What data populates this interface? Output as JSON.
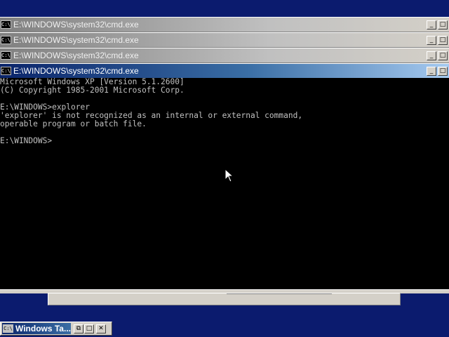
{
  "windows": [
    {
      "title": "E:\\WINDOWS\\system32\\cmd.exe",
      "state": "inactive"
    },
    {
      "title": "E:\\WINDOWS\\system32\\cmd.exe",
      "state": "inactive"
    },
    {
      "title": "E:\\WINDOWS\\system32\\cmd.exe",
      "state": "inactive"
    },
    {
      "title": "E:\\WINDOWS\\system32\\cmd.exe",
      "state": "active"
    }
  ],
  "caption_buttons": {
    "minimize": "_",
    "maximize": "□"
  },
  "system_icon_text": "C:\\",
  "console_lines": [
    "Microsoft Windows XP [Version 5.1.2600]",
    "(C) Copyright 1985-2001 Microsoft Corp.",
    "",
    "E:\\WINDOWS>explorer",
    "'explorer' is not recognized as an internal or external command,",
    "operable program or batch file.",
    "",
    "E:\\WINDOWS>"
  ],
  "minimized_window": {
    "title": "Windows Ta...",
    "restore": "⧉",
    "maximize": "□",
    "close": "✕"
  },
  "colors": {
    "desktop": "#0b1b6e",
    "active_title": "#0a246a",
    "inactive_title": "#808080",
    "console_bg": "#000000",
    "console_text": "#c0c0c0"
  }
}
